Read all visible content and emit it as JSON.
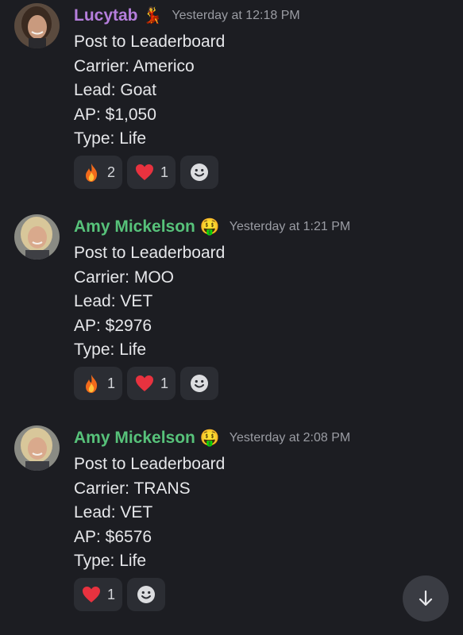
{
  "messages": [
    {
      "username": "Lucytab",
      "username_color": "#b57edc",
      "name_emoji": "💃",
      "timestamp": "Yesterday at 12:18 PM",
      "lines": [
        "Post to Leaderboard",
        "Carrier: Americo",
        "Lead: Goat",
        "AP: $1,050",
        "Type: Life"
      ],
      "reactions": [
        {
          "emoji": "fire-icon",
          "count": "2"
        },
        {
          "emoji": "heart-icon",
          "count": "1"
        }
      ]
    },
    {
      "username": "Amy Mickelson",
      "username_color": "#57c27a",
      "name_emoji": "🤑",
      "timestamp": "Yesterday at 1:21 PM",
      "lines": [
        "Post to Leaderboard",
        "Carrier: MOO",
        "Lead: VET",
        "AP: $2976",
        "Type: Life"
      ],
      "reactions": [
        {
          "emoji": "fire-icon",
          "count": "1"
        },
        {
          "emoji": "heart-icon",
          "count": "1"
        }
      ]
    },
    {
      "username": "Amy Mickelson",
      "username_color": "#57c27a",
      "name_emoji": "🤑",
      "timestamp": "Yesterday at 2:08 PM",
      "lines": [
        "Post to Leaderboard",
        "Carrier: TRANS",
        "Lead: VET",
        "AP: $6576",
        "Type: Life"
      ],
      "reactions": [
        {
          "emoji": "heart-icon",
          "count": "1"
        }
      ]
    }
  ],
  "icons": {
    "add_reaction": "smiley-add-reaction-icon",
    "scroll_down": "arrow-down-icon"
  },
  "colors": {
    "background": "#1c1d22",
    "reaction_bg": "#2b2d33",
    "timestamp": "#9a9ca3"
  }
}
